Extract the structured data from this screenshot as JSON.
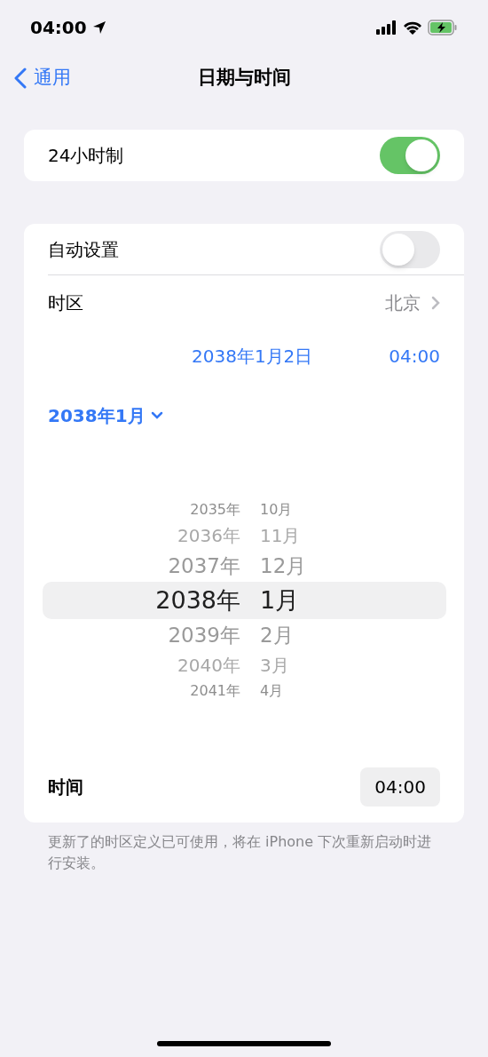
{
  "status_bar": {
    "time": "04:00"
  },
  "nav": {
    "back": "通用",
    "title": "日期与时间"
  },
  "format_card": {
    "label": "24小时制",
    "on": true
  },
  "settings_card": {
    "auto": {
      "label": "自动设置",
      "on": false
    },
    "timezone": {
      "label": "时区",
      "value": "北京"
    },
    "date": "2038年1月2日",
    "time_value": "04:00",
    "month_header": "2038年1月",
    "picker": [
      {
        "year": "2035年",
        "month": "10月",
        "selected": false
      },
      {
        "year": "2036年",
        "month": "11月",
        "selected": false
      },
      {
        "year": "2037年",
        "month": "12月",
        "selected": false
      },
      {
        "year": "2038年",
        "month": "1月",
        "selected": true
      },
      {
        "year": "2039年",
        "month": "2月",
        "selected": false
      },
      {
        "year": "2040年",
        "month": "3月",
        "selected": false
      },
      {
        "year": "2041年",
        "month": "4月",
        "selected": false
      }
    ],
    "time_row": {
      "label": "时间",
      "value": "04:00"
    }
  },
  "footer": "更新了的时区定义已可使用，将在 iPhone 下次重新启动时进行安装。"
}
